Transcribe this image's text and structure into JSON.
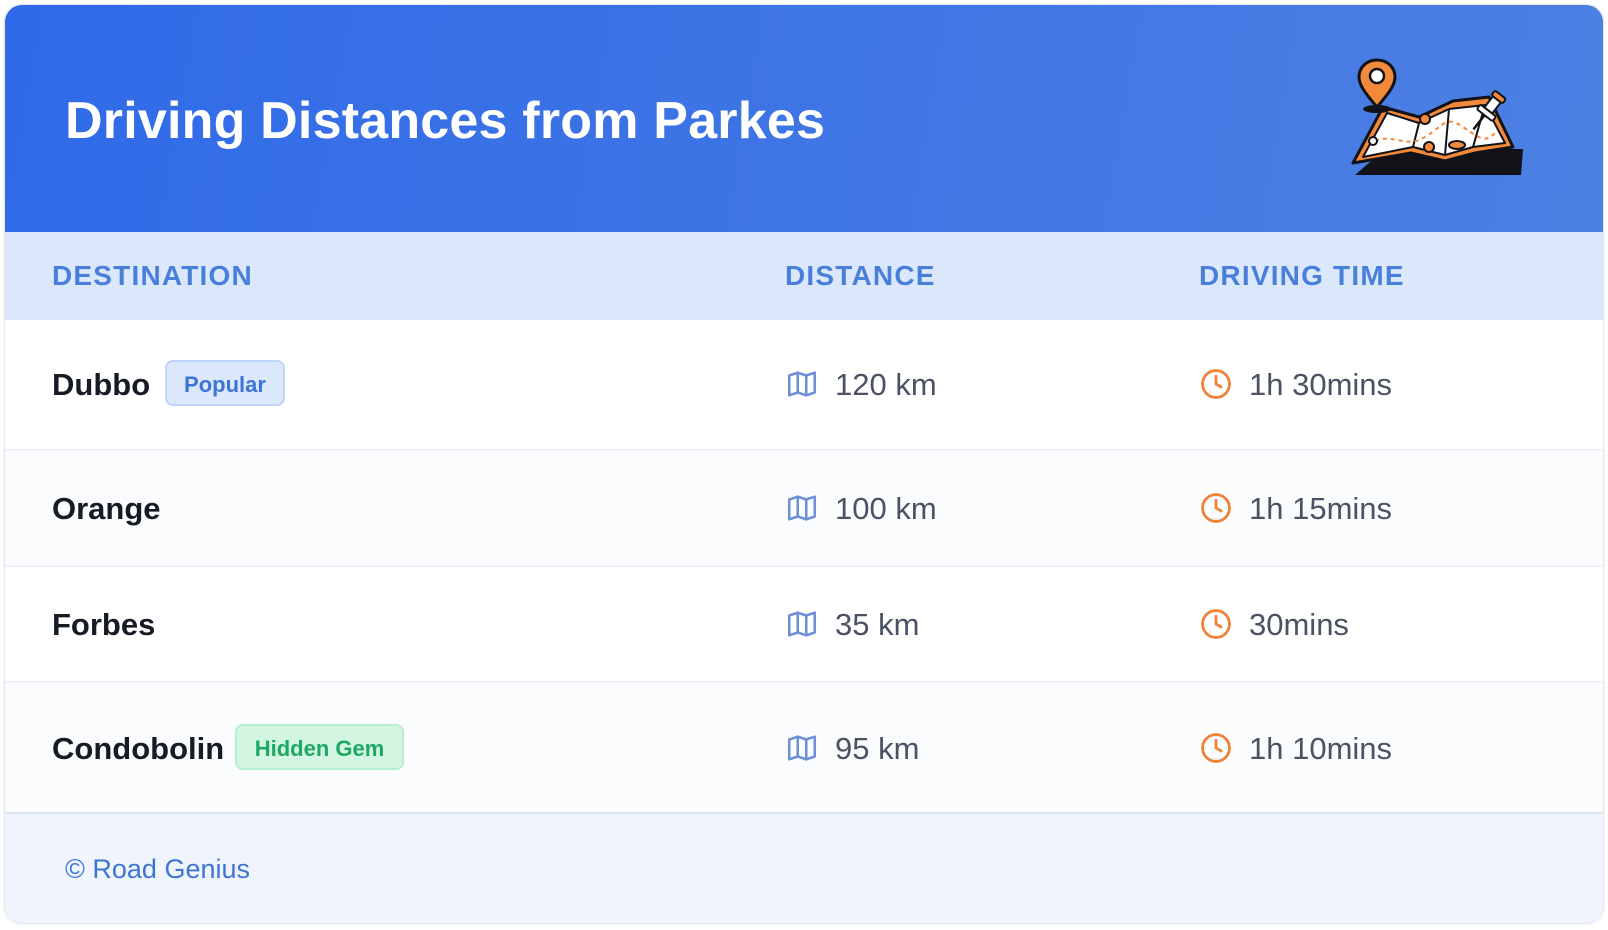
{
  "header": {
    "title": "Driving Distances from Parkes",
    "illustration_icon": "map-with-pins-icon",
    "gradient_start": "#2f6ae8",
    "gradient_end": "#4d80e3"
  },
  "table": {
    "columns": [
      "DESTINATION",
      "DISTANCE",
      "DRIVING TIME"
    ],
    "rows": [
      {
        "destination": "Dubbo",
        "badge": "Popular",
        "distance": "120 km",
        "driving_time": "1h 30mins"
      },
      {
        "destination": "Orange",
        "badge": null,
        "distance": "100 km",
        "driving_time": "1h 15mins"
      },
      {
        "destination": "Forbes",
        "badge": null,
        "distance": "35 km",
        "driving_time": "30mins"
      },
      {
        "destination": "Condobolin",
        "badge": "Hidden Gem",
        "distance": "95 km",
        "driving_time": "1h 10mins"
      }
    ],
    "distance_icon": "map-icon",
    "time_icon": "clock-icon"
  },
  "colors": {
    "accent": "#3d74d6",
    "header_text": "#4a7fd9",
    "clock_orange": "#f0843a",
    "popular_badge_bg": "#dbe8fc",
    "gem_badge_bg": "#d3f6e3",
    "gem_badge_text": "#1ea861"
  },
  "footer": {
    "text": "© Road Genius"
  }
}
